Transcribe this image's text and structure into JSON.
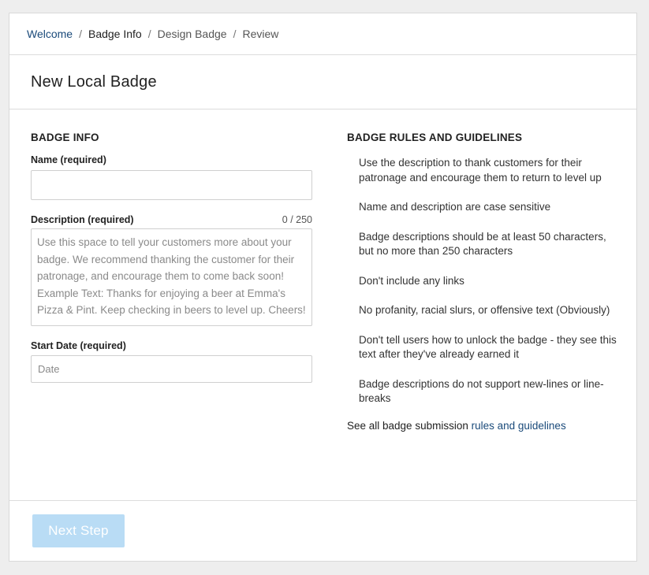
{
  "breadcrumb": [
    {
      "label": "Welcome",
      "state": "link"
    },
    {
      "label": "Badge Info",
      "state": "current"
    },
    {
      "label": "Design Badge",
      "state": "upcoming"
    },
    {
      "label": "Review",
      "state": "upcoming"
    }
  ],
  "breadcrumb_separator": "/",
  "page": {
    "title": "New Local Badge"
  },
  "form": {
    "section_title": "BADGE INFO",
    "name": {
      "label": "Name (required)",
      "value": "",
      "placeholder": ""
    },
    "description": {
      "label": "Description (required)",
      "counter": "0 / 250",
      "value": "",
      "placeholder": "Use this space to tell your customers more about your badge. We recommend thanking the customer for their patronage, and encourage them to come back soon! Example Text: Thanks for enjoying a beer at Emma's Pizza & Pint. Keep checking in beers to level up. Cheers!"
    },
    "start_date": {
      "label": "Start Date (required)",
      "value": "",
      "placeholder": "Date"
    }
  },
  "rules": {
    "title": "BADGE RULES AND GUIDELINES",
    "items": [
      "Use the description to thank customers for their patronage and encourage them to return to level up",
      "Name and description are case sensitive",
      "Badge descriptions should be at least 50 characters, but no more than 250 characters",
      "Don't include any links",
      "No profanity, racial slurs, or offensive text (Obviously)",
      "Don't tell users how to unlock the badge - they see this text after they've already earned it",
      "Badge descriptions do not support new-lines or line-breaks"
    ],
    "footer_text": "See all badge submission ",
    "footer_link": "rules and guidelines"
  },
  "footer": {
    "next_button": "Next Step",
    "next_enabled": false
  },
  "colors": {
    "link": "#1a4a7a",
    "button_disabled": "#b9dcf5",
    "border": "#dcdcdc"
  }
}
